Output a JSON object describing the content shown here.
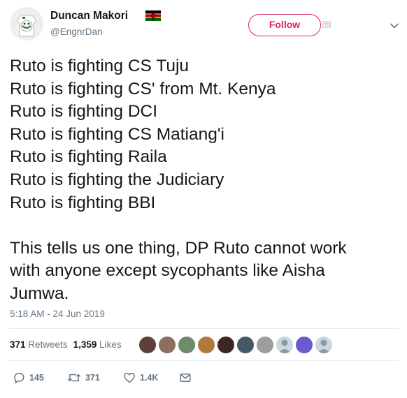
{
  "author": {
    "name": "Duncan Makori",
    "handle": "@EngnrDan"
  },
  "follow_label": "Follow",
  "tweet": {
    "text": "Ruto is fighting CS Tuju\nRuto is fighting CS' from Mt. Kenya\nRuto is fighting DCI\nRuto is fighting CS Matiang'i\nRuto is fighting Raila\nRuto is fighting the Judiciary\nRuto is fighting BBI\n\nThis tells us one thing, DP Ruto cannot work\nwith anyone except sycophants like Aisha\nJumwa."
  },
  "timestamp": "5:18 AM - 24 Jun 2019",
  "stats": {
    "retweets_count": "371",
    "retweets_label": "Retweets",
    "likes_count": "1,359",
    "likes_label": "Likes"
  },
  "actions": {
    "replies": "145",
    "retweets": "371",
    "likes": "1.4K"
  },
  "colors": {
    "accent": "#e0245e",
    "muted": "#657786",
    "text": "#14171a",
    "divider": "#e6ecf0"
  },
  "icons": [
    "kenya-flag-icon",
    "chevron-down-icon",
    "reply-icon",
    "retweet-icon",
    "heart-icon",
    "message-icon"
  ]
}
